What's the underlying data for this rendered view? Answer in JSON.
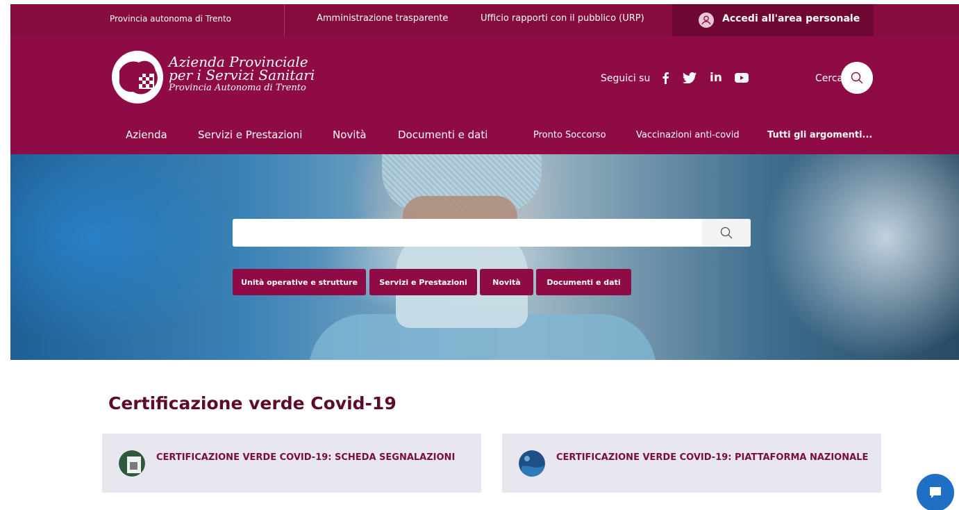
{
  "colors": {
    "brand": "#8f0b46",
    "topbar": "#860c3e",
    "title": "#5e0a2b",
    "card": "#e8e6ee",
    "chat": "#1f6fc5"
  },
  "topbar": {
    "province_link": "Provincia autonoma di Trento",
    "transparency_link": "Amministrazione trasparente",
    "urp_link": "Ufficio rapporti con il pubblico (URP)",
    "login_label": "Accedi all'area personale"
  },
  "header": {
    "brand_line1": "Azienda Provinciale",
    "brand_line2": "per i Servizi Sanitari",
    "brand_line3": "Provincia Autonoma di Trento",
    "follow_label": "Seguici su",
    "social": [
      "facebook-icon",
      "twitter-icon",
      "linkedin-icon",
      "youtube-icon"
    ],
    "search_label": "Cerca"
  },
  "nav": {
    "items": [
      "Azienda",
      "Servizi e Prestazioni",
      "Novità",
      "Documenti e dati"
    ],
    "secondary": [
      "Pronto Soccorso",
      "Vaccinazioni anti-covid"
    ],
    "all_topics": "Tutti gli argomenti..."
  },
  "hero": {
    "search_value": "",
    "chips": [
      "Unità operative e strutture",
      "Servizi e Prestazioni",
      "Novità",
      "Documenti e dati"
    ]
  },
  "section": {
    "title": "Certificazione verde Covid-19",
    "cards": [
      {
        "title": "CERTIFICAZIONE VERDE COVID-19: SCHEDA SEGNALAZIONI"
      },
      {
        "title": "CERTIFICAZIONE VERDE COVID-19: PIATTAFORMA NAZIONALE"
      }
    ]
  }
}
